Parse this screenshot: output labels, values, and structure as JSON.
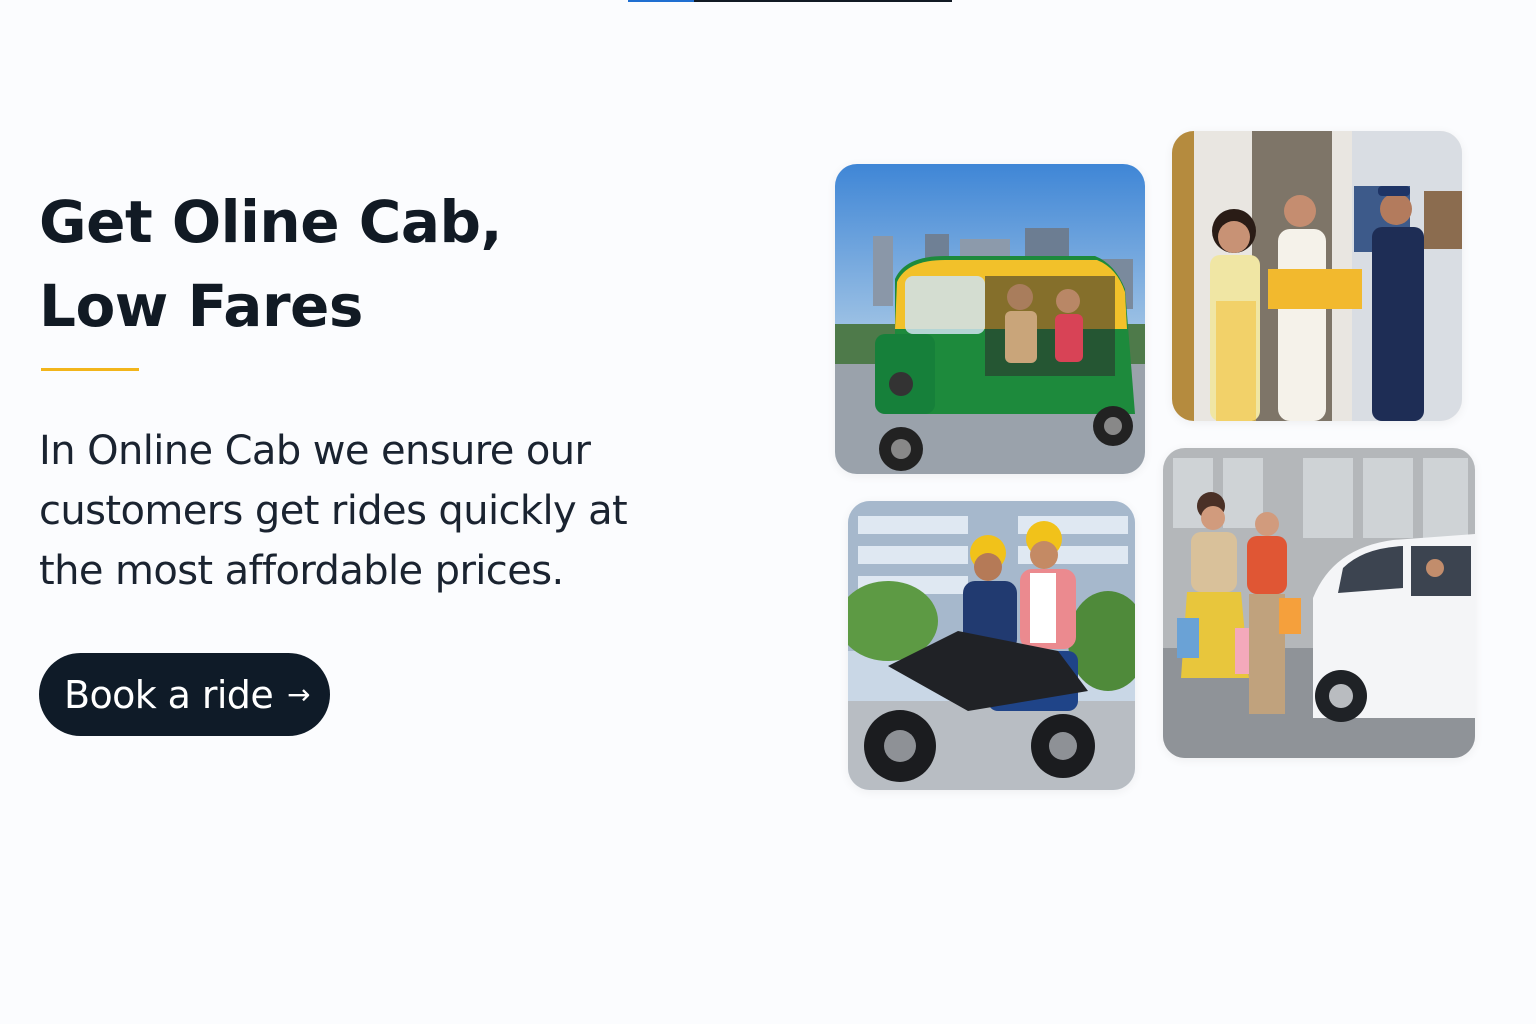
{
  "hero": {
    "title_line1": "Get Oline Cab,",
    "title_line2": "Low Fares",
    "description": "In Online Cab we ensure our customers get rides quickly at the most affordable prices.",
    "cta_label": "Book a ride",
    "cta_icon": "arrow-right-icon",
    "accent_color": "#f2b51b",
    "button_color": "#0f1b28"
  },
  "gallery": {
    "images": [
      {
        "subject": "auto-rickshaw-ride"
      },
      {
        "subject": "parcel-delivery"
      },
      {
        "subject": "bike-taxi-ride"
      },
      {
        "subject": "car-ride"
      }
    ]
  }
}
